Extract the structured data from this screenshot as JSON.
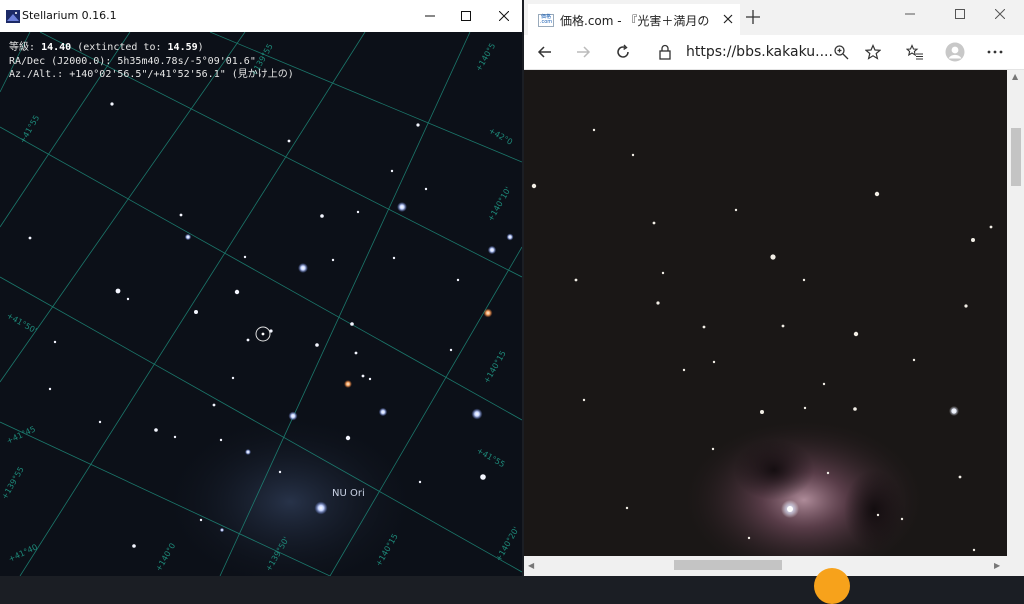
{
  "stellarium": {
    "title": "Stellarium 0.16.1",
    "info": {
      "mag_label": "等級:",
      "mag_value": "14.40",
      "ext_label": "(extincted to:",
      "ext_value": "14.59",
      "ext_close": ")",
      "radec": "RA/Dec (J2000.0): 5h35m40.78s/-5°09'01.6\"",
      "azalt": "Az./Alt.: +140°02'56.5\"/+41°52'56.1\" (見かけ上の)"
    },
    "label_nu_ori": "NU Ori",
    "grid_labels": [
      "+41°55",
      "+42°0",
      "+41°50'",
      "+41°45",
      "+140°10'",
      "+140°15",
      "+41°55",
      "+140°20'",
      "+139°55",
      "+139°55",
      "+140°5",
      "+41°40",
      "+140°15",
      "+139°50'",
      "+140°0"
    ]
  },
  "edge": {
    "tab_title": "価格.com - 『光害＋満月のオリオン",
    "favicon_text": "価格 .com",
    "url": "https://bbs.kakaku....",
    "icons": [
      "back-icon",
      "forward-icon",
      "refresh-icon",
      "lock-icon",
      "zoom-icon",
      "star-icon",
      "favorites-icon",
      "profile-icon",
      "more-icon"
    ]
  },
  "colors": {
    "sky": "#0c1018",
    "grid": "#1e8a7a",
    "edge_tabbar": "#f2f2f2",
    "nebula": "#a07888"
  }
}
